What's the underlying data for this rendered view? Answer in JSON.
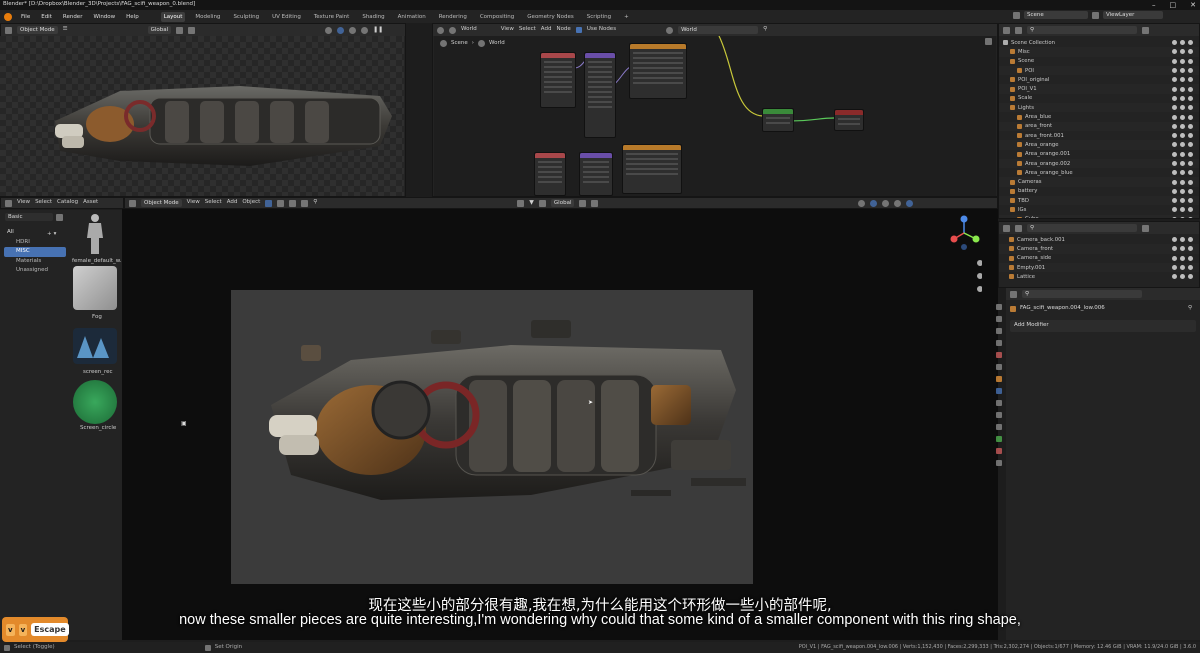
{
  "window": {
    "title": "Blender* [D:\\Dropbox\\Blender_3D\\Projects\\FAG_scifi_weapon_0.blend]"
  },
  "menu": [
    "File",
    "Edit",
    "Render",
    "Window",
    "Help"
  ],
  "workspaces": [
    "Layout",
    "Modeling",
    "Sculpting",
    "UV Editing",
    "Texture Paint",
    "Shading",
    "Animation",
    "Rendering",
    "Compositing",
    "Geometry Nodes",
    "Scripting"
  ],
  "active_workspace": "Layout",
  "top_left_header": {
    "mode": "Object Mode",
    "orientation": "Global"
  },
  "node_header": {
    "world_label": "World",
    "menus": [
      "View",
      "Select",
      "Add",
      "Node"
    ],
    "use_nodes": "Use Nodes",
    "world_name": "World"
  },
  "node_breadcrumb": {
    "scene": "Scene",
    "world": "World"
  },
  "scene_selector": {
    "scene": "Scene",
    "view_layer": "ViewLayer"
  },
  "outliner": [
    {
      "label": "Scene Collection",
      "depth": 0
    },
    {
      "label": "Misc",
      "depth": 1
    },
    {
      "label": "Scene",
      "depth": 1
    },
    {
      "label": "POI",
      "depth": 2
    },
    {
      "label": "POI_original",
      "depth": 1
    },
    {
      "label": "POI_V1",
      "depth": 1
    },
    {
      "label": "Scale",
      "depth": 1
    },
    {
      "label": "Lights",
      "depth": 1
    },
    {
      "label": "Area_blue",
      "depth": 2
    },
    {
      "label": "area_front",
      "depth": 2
    },
    {
      "label": "area_front.001",
      "depth": 2
    },
    {
      "label": "Area_orange",
      "depth": 2
    },
    {
      "label": "Area_orange.001",
      "depth": 2
    },
    {
      "label": "Area_orange.002",
      "depth": 2
    },
    {
      "label": "Area_orange_blue",
      "depth": 2
    },
    {
      "label": "Cameras",
      "depth": 1
    },
    {
      "label": "battery",
      "depth": 1
    },
    {
      "label": "TBD",
      "depth": 1
    },
    {
      "label": "IGs",
      "depth": 1
    },
    {
      "label": "Cube",
      "depth": 2
    }
  ],
  "outliner2": [
    {
      "label": "Camera_back.001"
    },
    {
      "label": "Camera_front"
    },
    {
      "label": "Camera_side"
    },
    {
      "label": "Empty.001"
    },
    {
      "label": "Lattice"
    }
  ],
  "asset_browser": {
    "menus": [
      "View",
      "Select",
      "Catalog",
      "Asset"
    ],
    "library": "Basic",
    "catalogs": [
      "All",
      "HDRI",
      "MISC",
      "Materials",
      "Unassigned"
    ],
    "active_catalog": "MISC",
    "assets": [
      "female_default_w...",
      "Fog",
      "screen_rec",
      "Screen_circle"
    ]
  },
  "viewport_header": {
    "mode": "Object Mode",
    "menus": [
      "View",
      "Select",
      "Add",
      "Object"
    ],
    "orientation": "Global"
  },
  "properties": {
    "object_name": "FAG_scifi_weapon.004_low.006",
    "add_modifier": "Add Modifier"
  },
  "subtitles": {
    "zh": "现在这些小的部分很有趣,我在想,为什么能用这个环形做一些小的部件呢,",
    "en": "now these smaller pieces are quite interesting,I'm wondering why could that some kind of a smaller component with this ring shape,"
  },
  "keypress": {
    "keys": [
      "v",
      "v"
    ],
    "label": "Escape"
  },
  "statusbar": {
    "left": "Select (Toggle)",
    "middle": "Set Origin",
    "right": "POI_V1 | FAG_scifi_weapon.004_low.006 | Verts:1,152,430 | Faces:2,299,333 | Tris:2,302,274 | Objects:1/677 | Memory: 12.46 GiB | VRAM: 11.9/24.0 GiB | 3.6.0"
  },
  "colors": {
    "accent": "#4772b3",
    "escape_badge": "#e38a2b",
    "background": "#1d1d1d"
  }
}
